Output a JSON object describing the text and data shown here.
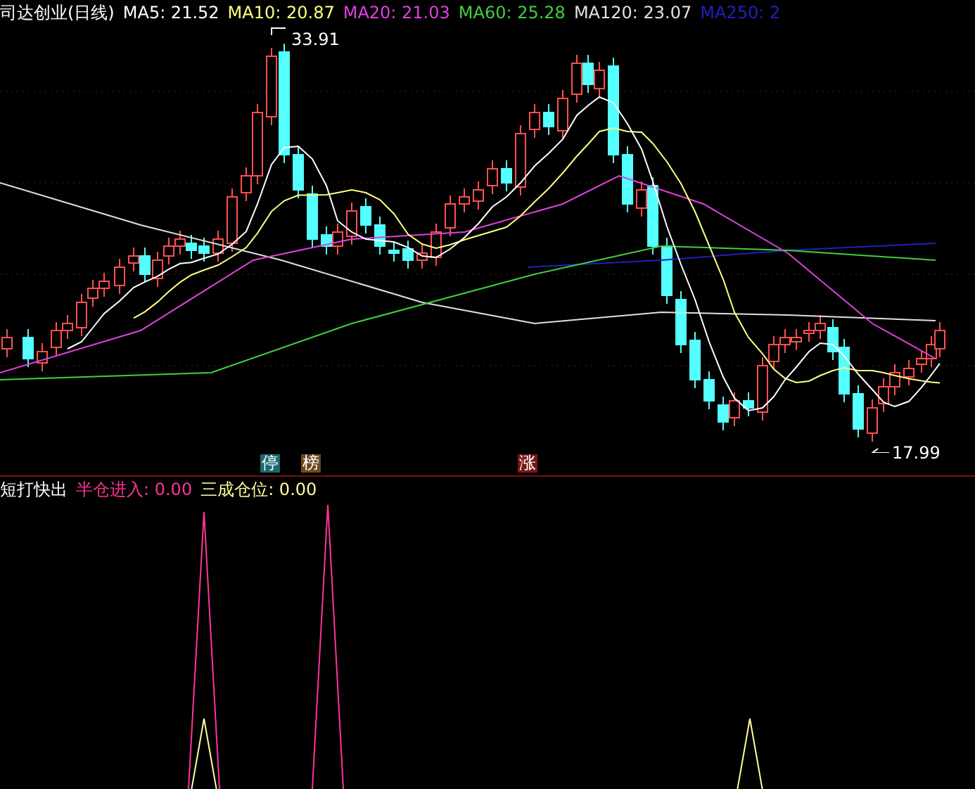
{
  "main_chart": {
    "title": "司达创业(日线)",
    "indicators": [
      {
        "label": "MA5: 21.52",
        "color": "#ffffff"
      },
      {
        "label": "MA10: 20.87",
        "color": "#ffff80"
      },
      {
        "label": "MA20: 21.03",
        "color": "#e040e0"
      },
      {
        "label": "MA60: 25.28",
        "color": "#40d040"
      },
      {
        "label": "MA120: 23.07",
        "color": "#e0e0e0"
      },
      {
        "label": "MA250: 2",
        "color": "#2020c0"
      }
    ],
    "high_label": "33.91",
    "low_label": "17.99",
    "markers": [
      {
        "text": "停",
        "color": "#1a6a70"
      },
      {
        "text": "榜",
        "color": "#6a4a20"
      },
      {
        "text": "涨",
        "color": "#7a1818"
      }
    ]
  },
  "sub_chart": {
    "title": "短打快出",
    "indicators": [
      {
        "label": "半仓进入: 0.00",
        "color": "#ff3399"
      },
      {
        "label": "三成仓位: 0.00",
        "color": "#ffff99"
      }
    ]
  }
}
